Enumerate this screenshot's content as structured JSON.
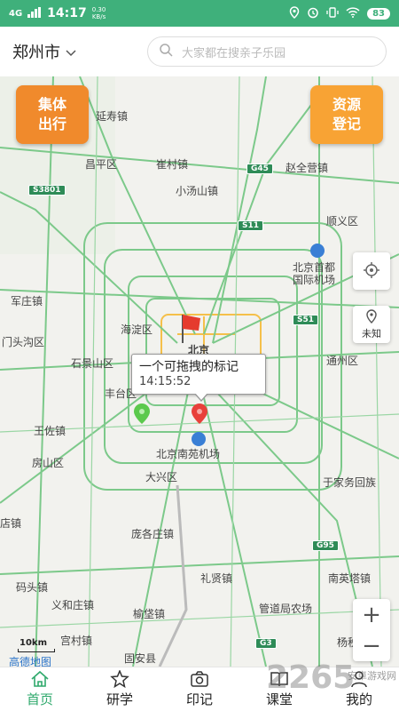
{
  "status": {
    "network": "4G",
    "time": "14:17",
    "speed": "0.30\nKB/s",
    "battery": "83"
  },
  "header": {
    "city": "郑州市",
    "search_placeholder": "大家都在搜亲子乐园"
  },
  "buttons": {
    "group_travel": "集体出行",
    "resource_register": "资源登记"
  },
  "controls": {
    "unknown_label": "未知",
    "zoom_in": "+",
    "zoom_out": "−"
  },
  "marker_popup": {
    "title": "一个可拖拽的标记",
    "time": "14:15:52"
  },
  "map_labels": [
    "延寿镇",
    "昌平区",
    "崔村镇",
    "赵全营镇",
    "小汤山镇",
    "顺义区",
    "北京首都",
    "国际机场",
    "军庄镇",
    "海淀区",
    "门头沟区",
    "石景山区",
    "北京",
    "通州区",
    "丰台区",
    "王佐镇",
    "北京南苑机场",
    "房山区",
    "大兴区",
    "于家务回族",
    "店镇",
    "庞各庄镇",
    "码头镇",
    "礼贤镇",
    "南英塔镇",
    "义和庄镇",
    "榆垡镇",
    "管道局农场",
    "宫村镇",
    "固安县",
    "杨税务"
  ],
  "road_shields": [
    "S3801",
    "G45",
    "S11",
    "S51",
    "G95",
    "G3"
  ],
  "scale": "10km",
  "map_logo": "高德地图",
  "tabs": [
    "首页",
    "研学",
    "印记",
    "课堂",
    "我的"
  ],
  "watermark": "2265",
  "watermark_sub": "安卓游戏网",
  "colors": {
    "primary": "#3fb07b",
    "orange": "#f08a2c",
    "road_green": "#7cc98a",
    "road_yellow": "#f5c04a"
  }
}
